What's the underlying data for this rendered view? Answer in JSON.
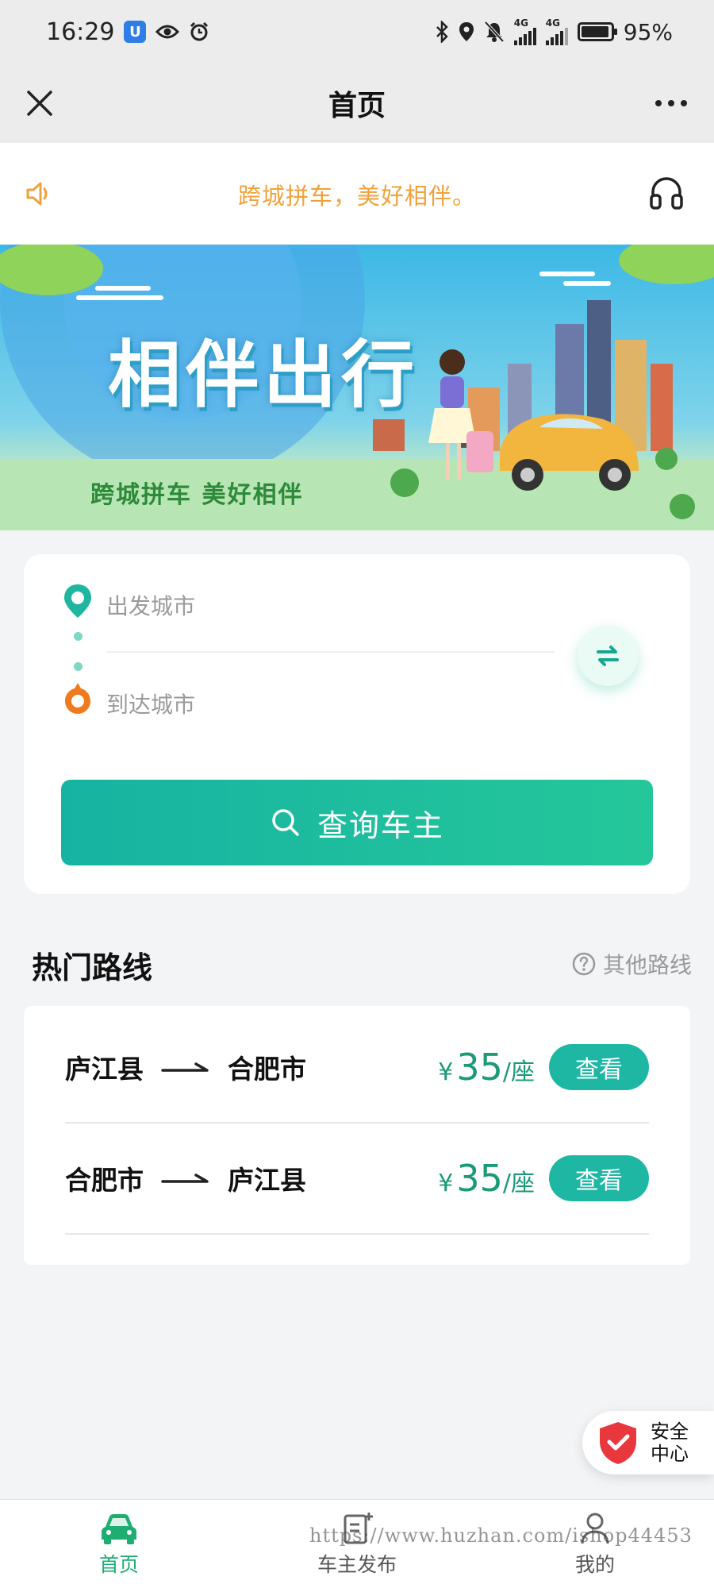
{
  "status_bar": {
    "time": "16:29",
    "battery_level": 0.95,
    "battery_text": "95%",
    "network_1": "4G",
    "network_2": "4G"
  },
  "title_bar": {
    "title": "首页"
  },
  "notice": {
    "text": "跨城拼车，美好相伴。"
  },
  "banner": {
    "title": "相伴出行",
    "subtitle": "跨城拼车 美好相伴"
  },
  "search": {
    "from_placeholder": "出发城市",
    "to_placeholder": "到达城市",
    "query_label": "查询车主"
  },
  "hot_routes": {
    "title": "热门路线",
    "other_label": "其他路线",
    "routes": [
      {
        "from": "庐江县",
        "to": "合肥市",
        "currency": "¥",
        "price": "35",
        "unit": "/座",
        "action": "查看"
      },
      {
        "from": "合肥市",
        "to": "庐江县",
        "currency": "¥",
        "price": "35",
        "unit": "/座",
        "action": "查看"
      }
    ]
  },
  "safety": {
    "label": "安全中心"
  },
  "tab_bar": {
    "items": [
      {
        "label": "首页",
        "icon": "car-icon"
      },
      {
        "label": "车主发布",
        "icon": "publish-icon"
      },
      {
        "label": "我的",
        "icon": "user-icon"
      }
    ]
  },
  "watermark": "https://www.huzhan.com/ishop44453",
  "colors": {
    "accent": "#1db7a3",
    "price": "#1a9a78",
    "notice": "#f0a23a",
    "active_tab": "#1aae72",
    "destination": "#f07a1e"
  }
}
